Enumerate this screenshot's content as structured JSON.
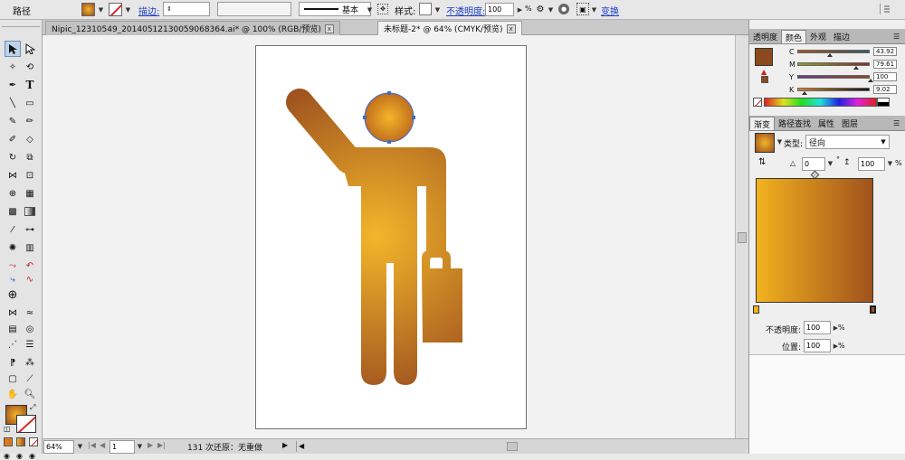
{
  "control_bar": {
    "object_type": "路径",
    "stroke_link": "描边:",
    "stroke_weight": "",
    "variable_width": "",
    "brush_profile": "基本",
    "style_label": "样式:",
    "opacity_link": "不透明度:",
    "opacity_value": "100",
    "opacity_unit": "%",
    "transform_link": "变换",
    "link_color": "#1a3fc4"
  },
  "tabs": [
    {
      "label": "Nipic_12310549_20140512130059068364.ai* @ 100% (RGB/预览)",
      "close": "x"
    },
    {
      "label": "未标题-2* @ 64% (CMYK/预览)",
      "close": "x"
    }
  ],
  "color_panel": {
    "tabs": [
      "透明度",
      "颜色",
      "外观",
      "描边"
    ],
    "active_tab": "颜色",
    "fill_color": "#8b4a1e",
    "channels": [
      {
        "label": "C",
        "value": "43.92",
        "fraction": 0.4392
      },
      {
        "label": "M",
        "value": "79.61",
        "fraction": 0.7961
      },
      {
        "label": "Y",
        "value": "100",
        "fraction": 1.0
      },
      {
        "label": "K",
        "value": "9.02",
        "fraction": 0.0902
      }
    ]
  },
  "gradient_panel": {
    "tabs": [
      "渐变",
      "路径查找",
      "属性",
      "图层"
    ],
    "active_tab": "渐变",
    "type_label": "类型:",
    "type_value": "径向",
    "angle_value": "0",
    "angle_unit": "°",
    "aspect_value": "100",
    "aspect_unit": "%",
    "start_color": "#f2b21e",
    "end_color": "#a0521c",
    "opacity_label": "不透明度:",
    "opacity_value": "100",
    "opacity_unit": "%",
    "location_label": "位置:",
    "location_value": "100",
    "location_unit": "%"
  },
  "status_bar": {
    "zoom": "64%",
    "artboard_number": "1",
    "history_text": "131 次还原：无重做"
  },
  "artwork": {
    "gradient_center": "#f3b62a",
    "gradient_edge": "#9b4e1e"
  }
}
